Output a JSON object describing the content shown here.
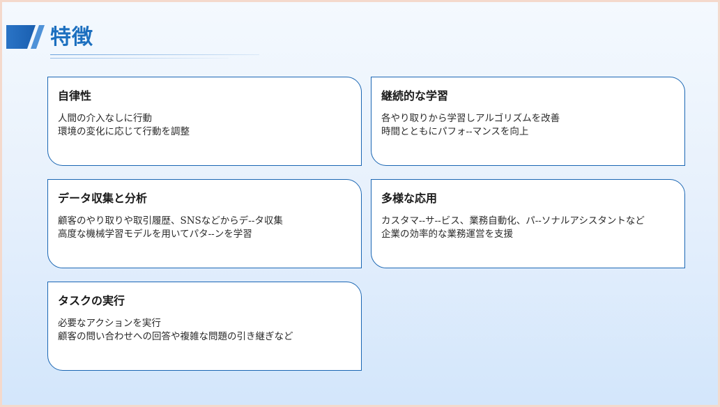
{
  "slide": {
    "title": "特徴",
    "accent_color": "#1a66b3"
  },
  "cards": [
    {
      "title": "自律性",
      "lines": [
        "人間の介入なしに行動",
        "環境の変化に応じて行動を調整"
      ]
    },
    {
      "title": "継続的な学習",
      "lines": [
        "各やり取りから学習しアルゴリズムを改善",
        "時間とともにパフォ--マンスを向上"
      ]
    },
    {
      "title": "データ収集と分析",
      "lines": [
        "顧客のやり取りや取引履歴、SNSなどからデ--タ収集",
        "高度な機械学習モデルを用いてパタ--ンを学習"
      ]
    },
    {
      "title": "多様な応用",
      "lines": [
        "カスタマ--サ--ビス、業務自動化、パ--ソナルアシスタントなど",
        "企業の効率的な業務運営を支援"
      ]
    },
    {
      "title": "タスクの実行",
      "lines": [
        "必要なアクションを実行",
        "顧客の問い合わせへの回答や複雑な問題の引き継ぎなど"
      ]
    }
  ]
}
